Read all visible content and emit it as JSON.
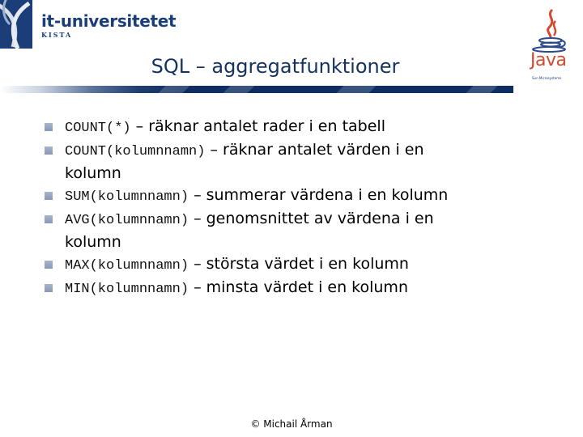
{
  "header": {
    "org_name": "it-universitetet",
    "org_sub": "KISTA",
    "java_word": "Java",
    "java_sub": "Sun Microsystems"
  },
  "slide": {
    "title": "SQL – aggregatfunktioner",
    "items": [
      {
        "code": "COUNT(*)",
        "desc": " – räknar antalet rader i en tabell",
        "cont": ""
      },
      {
        "code": "COUNT(kolumnnamn)",
        "desc": " – räknar antalet värden i en",
        "cont": "kolumn"
      },
      {
        "code": "SUM(kolumnnamn)",
        "desc": " – summerar värdena i en kolumn",
        "cont": ""
      },
      {
        "code": "AVG(kolumnnamn)",
        "desc": " – genomsnittet av värdena i en",
        "cont": "kolumn"
      },
      {
        "code": "MAX(kolumnnamn)",
        "desc": " – största värdet i en kolumn",
        "cont": ""
      },
      {
        "code": "MIN(kolumnnamn)",
        "desc": " – minsta värdet i en kolumn",
        "cont": ""
      }
    ]
  },
  "footer": {
    "copyright": "© Michail Årman"
  },
  "colors": {
    "brand_blue": "#1b3d78",
    "title_blue": "#14325e",
    "java_red": "#d24a2f"
  }
}
